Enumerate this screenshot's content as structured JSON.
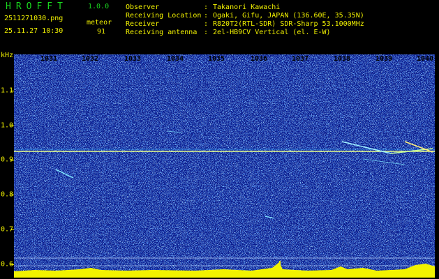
{
  "app": {
    "logo": "HROFFT",
    "version": "1.0.0",
    "filename": "2511271030.png",
    "datetime": "25.11.27 10:30",
    "counter_label": "meteor",
    "counter_value": "91"
  },
  "info": [
    {
      "key": "Observer",
      "value": "Takanori Kawachi"
    },
    {
      "key": "Receiving Location",
      "value": "Ogaki, Gifu, JAPAN (136.60E, 35.35N)"
    },
    {
      "key": "Receiver",
      "value": "R820T2(RTL-SDR) SDR-Sharp 53.1000MHz"
    },
    {
      "key": "Receiving antenna",
      "value": "2el-HB9CV Vertical (el. E-W)"
    }
  ],
  "axis": {
    "y_unit": "kHz",
    "x_ticks": [
      "1031",
      "1032",
      "1033",
      "1034",
      "1035",
      "1036",
      "1037",
      "1038",
      "1039",
      "1040"
    ],
    "y_ticks": [
      "1.1",
      "1.0",
      "0.9",
      "0.8",
      "0.7",
      "0.6"
    ]
  },
  "colors": {
    "background": "#000000",
    "plot_noise_base": "#0a1a8c",
    "carrier": "#e8ff8a",
    "header_yellow": "#f2f200",
    "logo_green": "#19d61e",
    "spectrum_bar": "#f2f200"
  }
}
